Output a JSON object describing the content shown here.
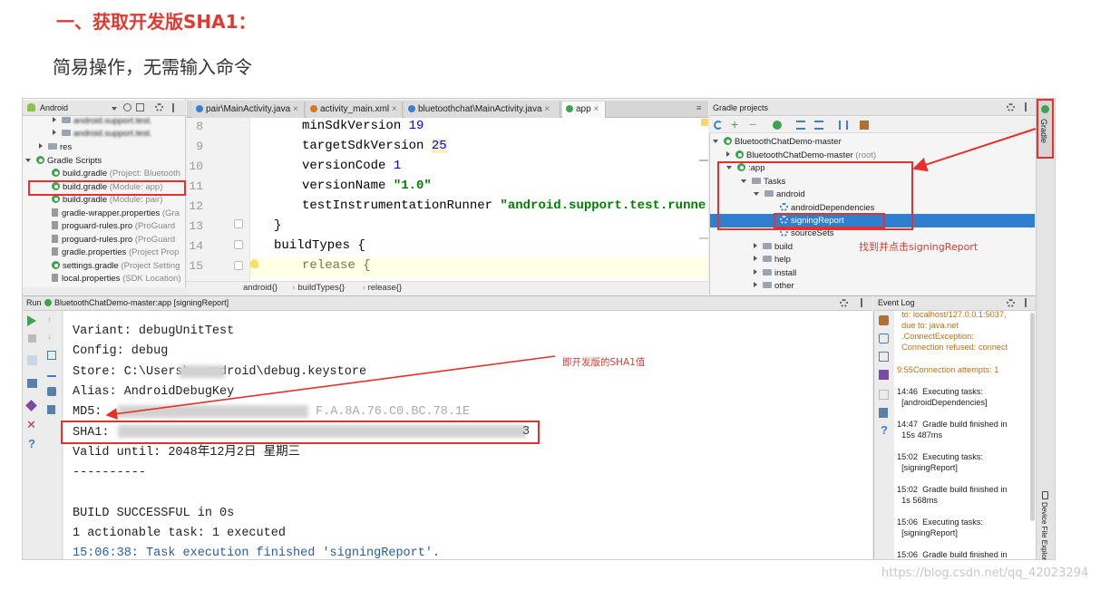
{
  "doc": {
    "heading": "一、获取开发版SHA1：",
    "subtitle": "简易操作，无需输入命令"
  },
  "project_panel": {
    "view_selector": "Android",
    "items": [
      {
        "label": "android.support.test.",
        "gray": "",
        "blurred": true
      },
      {
        "label": "android.support.test.",
        "gray": "",
        "blurred": true
      },
      {
        "label": "res",
        "gray": ""
      },
      {
        "label": "Gradle Scripts",
        "gray": ""
      },
      {
        "label": "build.gradle",
        "gray": "(Project: Bluetooth"
      },
      {
        "label": "build.gradle",
        "gray": "(Module: app)"
      },
      {
        "label": "build.gradle",
        "gray": "(Module: pair)"
      },
      {
        "label": "gradle-wrapper.properties",
        "gray": "(Gra"
      },
      {
        "label": "proguard-rules.pro",
        "gray": "(ProGuard"
      },
      {
        "label": "proguard-rules.pro",
        "gray": "(ProGuard"
      },
      {
        "label": "gradle.properties",
        "gray": "(Project Prop"
      },
      {
        "label": "settings.gradle",
        "gray": "(Project Setting"
      },
      {
        "label": "local.properties",
        "gray": "(SDK Location)"
      }
    ]
  },
  "editor": {
    "tabs": [
      "pair\\MainActivity.java",
      "activity_main.xml",
      "bluetoothchat\\MainActivity.java",
      "app"
    ],
    "line_numbers": [
      "8",
      "9",
      "10",
      "11",
      "12",
      "13",
      "14",
      "15"
    ],
    "lines": [
      {
        "a": "minSdkVersion ",
        "b": "19",
        "c": ""
      },
      {
        "a": "targetSdkVersion ",
        "b": "25",
        "c": ""
      },
      {
        "a": "versionCode ",
        "b": "1",
        "c": ""
      },
      {
        "a": "versionName ",
        "b": "",
        "c": "\"1.0\""
      },
      {
        "a": "testInstrumentationRunner ",
        "b": "",
        "c": "\"android.support.test.runner."
      },
      {
        "a": "}",
        "b": "",
        "c": ""
      },
      {
        "a": "buildTypes {",
        "b": "",
        "c": ""
      },
      {
        "a": "release {",
        "b": "",
        "c": ""
      }
    ],
    "breadcrumb": [
      "android{}",
      "buildTypes{}",
      "release{}"
    ]
  },
  "gradle_panel": {
    "title": "Gradle projects",
    "side_tab": "Gradle",
    "items": [
      {
        "label": "BluetoothChatDemo-master",
        "gray": ""
      },
      {
        "label": "BluetoothChatDemo-master",
        "gray": "(root)"
      },
      {
        "label": ":app",
        "gray": ""
      },
      {
        "label": "Tasks",
        "gray": ""
      },
      {
        "label": "android",
        "gray": ""
      },
      {
        "label": "androidDependencies",
        "gray": ""
      },
      {
        "label": "signingReport",
        "gray": ""
      },
      {
        "label": "sourceSets",
        "gray": ""
      },
      {
        "label": "build",
        "gray": ""
      },
      {
        "label": "help",
        "gray": ""
      },
      {
        "label": "install",
        "gray": ""
      },
      {
        "label": "other",
        "gray": ""
      }
    ]
  },
  "run_panel": {
    "title": "Run",
    "tab_label": "BluetoothChatDemo-master:app [signingReport]",
    "lines": [
      "Variant: debugUnitTest",
      "Config: debug",
      "Store: C:\\Users\\      .android\\debug.keystore",
      "Alias: AndroidDebugKey",
      "MD5:",
      "SHA1:",
      "Valid until: 2048年12月2日 星期三",
      "----------",
      "",
      "BUILD SUCCESSFUL in 0s",
      "1 actionable task: 1 executed",
      "15:06:38: Task execution finished 'signingReport'."
    ],
    "md5_tail": "F.A.8A.76.C0.BC.78.1E",
    "sha1_tail": "3"
  },
  "event_log": {
    "title": "Event Log",
    "entries": [
      {
        "text": "  to: localhost/127.0.0.1:5037,\n  due to: java.net\n  .ConnectException:\n  Connection refused: connect",
        "orange": true
      },
      {
        "text": "9:55Connection attempts: 1",
        "orange": true
      },
      {
        "text": "14:46  Executing tasks:\n  [androidDependencies]",
        "orange": false
      },
      {
        "text": "14:47  Gradle build finished in\n  15s 487ms",
        "orange": false
      },
      {
        "text": "15:02  Executing tasks:\n  [signingReport]",
        "orange": false
      },
      {
        "text": "15:02  Gradle build finished in\n  1s 568ms",
        "orange": false
      },
      {
        "text": "15:06  Executing tasks:\n  [signingReport]",
        "orange": false
      },
      {
        "text": "15:06  Gradle build finished in",
        "orange": false
      }
    ],
    "side_tab": "Device File Explorer"
  },
  "annotations": {
    "click_signing": "找到并点击signingReport",
    "sha1_value": "即开发版的SHA1值"
  },
  "watermark": "https://blog.csdn.net/qq_42023294",
  "colors": {
    "annotation_red": "#e8302a",
    "selection_blue": "#2f7fd0",
    "gradle_green": "#3fa34d"
  }
}
